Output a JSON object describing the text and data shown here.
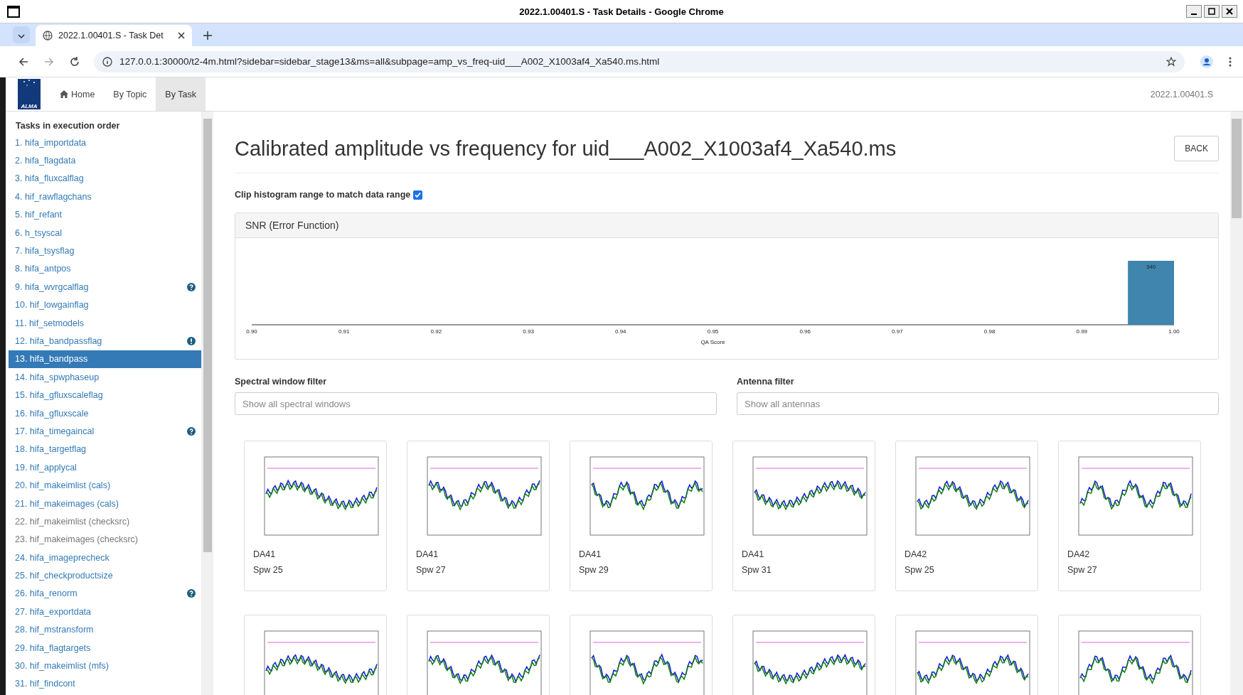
{
  "window": {
    "title": "2022.1.00401.S - Task Details - Google Chrome"
  },
  "browser": {
    "tab_title": "2022.1.00401.S - Task Det",
    "url": "127.0.0.1:30000/t2-4m.html?sidebar=sidebar_stage13&ms=all&subpage=amp_vs_freq-uid___A002_X1003af4_Xa540.ms.html"
  },
  "navbar": {
    "logo": "ALMA",
    "items": [
      {
        "label": "Home",
        "selected": false,
        "kind": "home"
      },
      {
        "label": "By Topic",
        "selected": false,
        "kind": "plain"
      },
      {
        "label": "By Task",
        "selected": true,
        "kind": "plain"
      }
    ],
    "version": "2022.1.00401.S"
  },
  "sidebar": {
    "heading": "Tasks in execution order",
    "items": [
      {
        "label": "1. hifa_importdata",
        "selected": false,
        "disabled": false
      },
      {
        "label": "2. hifa_flagdata",
        "selected": false,
        "disabled": false
      },
      {
        "label": "3. hifa_fluxcalflag",
        "selected": false,
        "disabled": false
      },
      {
        "label": "4. hif_rawflagchans",
        "selected": false,
        "disabled": false
      },
      {
        "label": "5. hif_refant",
        "selected": false,
        "disabled": false
      },
      {
        "label": "6. h_tsyscal",
        "selected": false,
        "disabled": false
      },
      {
        "label": "7. hifa_tsysflag",
        "selected": false,
        "disabled": false
      },
      {
        "label": "8. hifa_antpos",
        "selected": false,
        "disabled": false
      },
      {
        "label": "9. hifa_wvrgcalflag",
        "selected": false,
        "disabled": false,
        "kind": "question"
      },
      {
        "label": "10. hif_lowgainflag",
        "selected": false,
        "disabled": false
      },
      {
        "label": "11. hif_setmodels",
        "selected": false,
        "disabled": false
      },
      {
        "label": "12. hifa_bandpassflag",
        "selected": false,
        "disabled": false,
        "kind": "exclamation"
      },
      {
        "label": "13. hifa_bandpass",
        "selected": true,
        "disabled": false
      },
      {
        "label": "14. hifa_spwphaseup",
        "selected": false,
        "disabled": false
      },
      {
        "label": "15. hifa_gfluxscaleflag",
        "selected": false,
        "disabled": false
      },
      {
        "label": "16. hifa_gfluxscale",
        "selected": false,
        "disabled": false
      },
      {
        "label": "17. hifa_timegaincal",
        "selected": false,
        "disabled": false,
        "kind": "question"
      },
      {
        "label": "18. hifa_targetflag",
        "selected": false,
        "disabled": false
      },
      {
        "label": "19. hif_applycal",
        "selected": false,
        "disabled": false
      },
      {
        "label": "20. hif_makeimlist (cals)",
        "selected": false,
        "disabled": false
      },
      {
        "label": "21. hif_makeimages (cals)",
        "selected": false,
        "disabled": false
      },
      {
        "label": "22. hif_makeimlist (checksrc)",
        "selected": false,
        "disabled": true
      },
      {
        "label": "23. hif_makeimages (checksrc)",
        "selected": false,
        "disabled": true
      },
      {
        "label": "24. hifa_imageprecheck",
        "selected": false,
        "disabled": false
      },
      {
        "label": "25. hif_checkproductsize",
        "selected": false,
        "disabled": false
      },
      {
        "label": "26. hifa_renorm",
        "selected": false,
        "disabled": false,
        "kind": "question"
      },
      {
        "label": "27. hifa_exportdata",
        "selected": false,
        "disabled": false
      },
      {
        "label": "28. hif_mstransform",
        "selected": false,
        "disabled": false
      },
      {
        "label": "29. hifa_flagtargets",
        "selected": false,
        "disabled": false
      },
      {
        "label": "30. hif_makeimlist (mfs)",
        "selected": false,
        "disabled": false
      },
      {
        "label": "31. hif_findcont",
        "selected": false,
        "disabled": false
      }
    ]
  },
  "page": {
    "title": "Calibrated amplitude vs frequency for uid___A002_X1003af4_Xa540.ms",
    "back_button": "BACK",
    "clip_checkbox": {
      "label": "Clip histogram range to match data range",
      "checked": true
    },
    "histogram": {
      "title": "SNR (Error Function)",
      "chart_data": {
        "type": "bar",
        "xlabel": "QA Score",
        "x": [
          0.9975
        ],
        "values": [
          340
        ],
        "xlim": [
          0.9,
          1.0
        ],
        "xticks": [
          {
            "value": 0.9,
            "label": "0.90"
          },
          {
            "value": 0.91,
            "label": "0.91"
          },
          {
            "value": 0.92,
            "label": "0.92"
          },
          {
            "value": 0.93,
            "label": "0.93"
          },
          {
            "value": 0.94,
            "label": "0.94"
          },
          {
            "value": 0.95,
            "label": "0.95"
          },
          {
            "value": 0.96,
            "label": "0.96"
          },
          {
            "value": 0.97,
            "label": "0.97"
          },
          {
            "value": 0.98,
            "label": "0.98"
          },
          {
            "value": 0.99,
            "label": "0.99"
          },
          {
            "value": 1.0,
            "label": "1.00"
          }
        ],
        "data_labels": true
      }
    },
    "filters": [
      {
        "label": "Spectral window filter",
        "placeholder": "Show all spectral windows"
      },
      {
        "label": "Antenna filter",
        "placeholder": "Show all antennas"
      }
    ],
    "thumbnails": [
      {
        "kind": "plot",
        "antenna": "DA41",
        "spw": "Spw 25"
      },
      {
        "kind": "plot",
        "antenna": "DA41",
        "spw": "Spw 27"
      },
      {
        "kind": "plot",
        "antenna": "DA41",
        "spw": "Spw 29"
      },
      {
        "kind": "plot",
        "antenna": "DA41",
        "spw": "Spw 31"
      },
      {
        "kind": "plot",
        "antenna": "DA42",
        "spw": "Spw 25"
      },
      {
        "kind": "plot",
        "antenna": "DA42",
        "spw": "Spw 27"
      },
      {
        "kind": "plot"
      },
      {
        "kind": "plot"
      },
      {
        "kind": "plot"
      },
      {
        "kind": "plot"
      },
      {
        "kind": "plot"
      },
      {
        "kind": "plot"
      }
    ]
  }
}
